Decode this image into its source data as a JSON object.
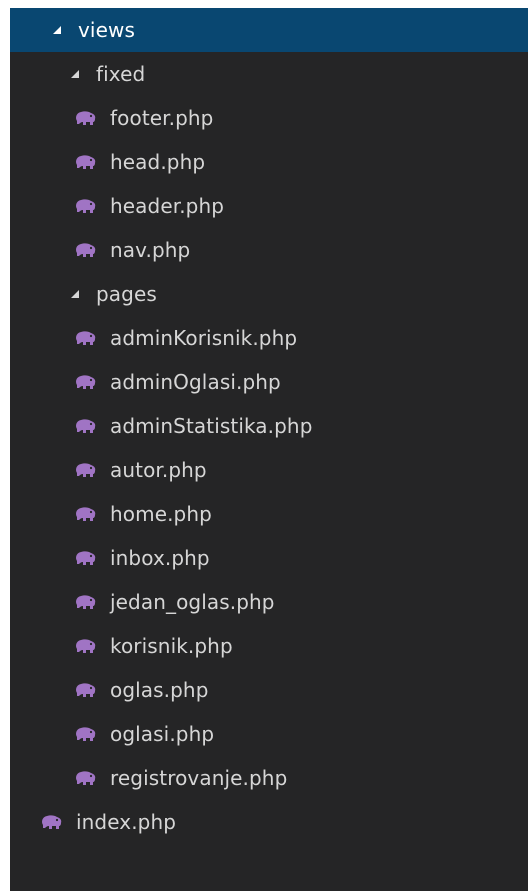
{
  "explorer": {
    "root_folder": {
      "label": "views",
      "folders": [
        {
          "label": "fixed",
          "files": [
            "footer.php",
            "head.php",
            "header.php",
            "nav.php"
          ]
        },
        {
          "label": "pages",
          "files": [
            "adminKorisnik.php",
            "adminOglasi.php",
            "adminStatistika.php",
            "autor.php",
            "home.php",
            "inbox.php",
            "jedan_oglas.php",
            "korisnik.php",
            "oglas.php",
            "oglasi.php",
            "registrovanje.php"
          ]
        }
      ]
    },
    "root_files": [
      "index.php"
    ],
    "icons": {
      "expanded_folder": "chevron-down-icon",
      "php_file": "php-elephant-icon"
    },
    "colors": {
      "background": "#252526",
      "selected_row": "#094771",
      "php_icon": "#a074c4",
      "text": "#d6d6d6"
    }
  }
}
